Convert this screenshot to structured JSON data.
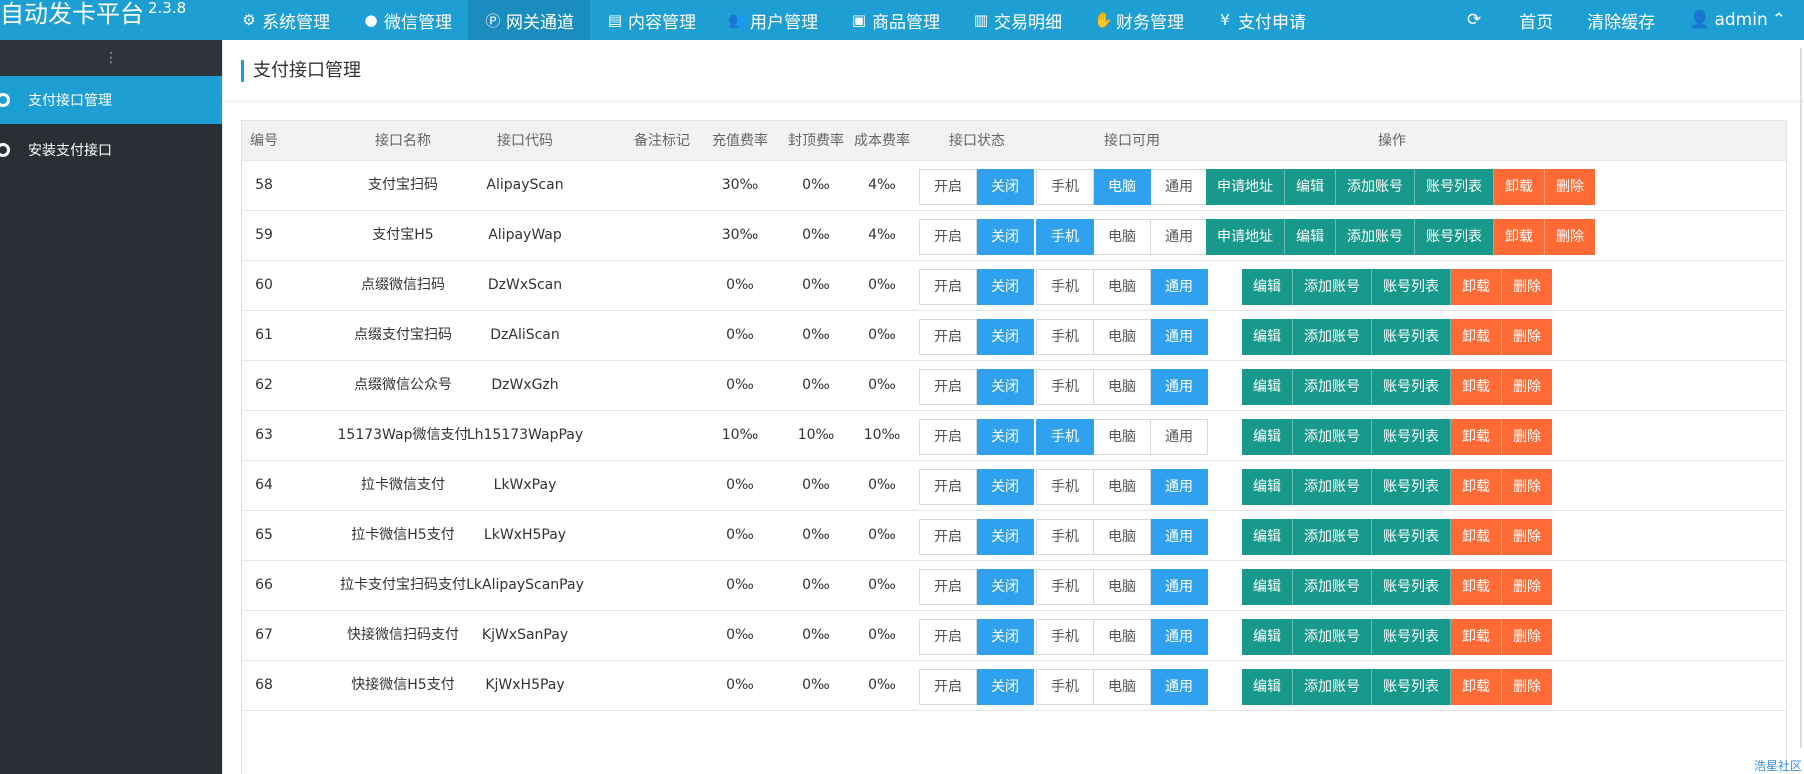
{
  "app": {
    "brand": "自动发卡平台",
    "version": "2.3.8"
  },
  "nav": [
    {
      "icon": "gear-icon",
      "glyph": "⚙",
      "label": "系统管理"
    },
    {
      "icon": "wechat-icon",
      "glyph": "●",
      "label": "微信管理"
    },
    {
      "icon": "gateway-icon",
      "glyph": "Ⓟ",
      "label": "网关通道",
      "active": true
    },
    {
      "icon": "document-icon",
      "glyph": "▤",
      "label": "内容管理"
    },
    {
      "icon": "users-icon",
      "glyph": "👥",
      "label": "用户管理"
    },
    {
      "icon": "bag-icon",
      "glyph": "▣",
      "label": "商品管理"
    },
    {
      "icon": "bar-chart-icon",
      "glyph": "▥",
      "label": "交易明细"
    },
    {
      "icon": "finance-icon",
      "glyph": "✋",
      "label": "财务管理"
    },
    {
      "icon": "yen-icon",
      "glyph": "¥",
      "label": "支付申请"
    }
  ],
  "nav_right": {
    "home": "首页",
    "clear_cache": "清除缓存",
    "user": "admin"
  },
  "sidebar": {
    "items": [
      {
        "label": "支付接口管理",
        "active": true
      },
      {
        "label": "安装支付接口",
        "active": false
      }
    ]
  },
  "page": {
    "title": "支付接口管理"
  },
  "table": {
    "headers": {
      "id": "编号",
      "name": "接口名称",
      "code": "接口代码",
      "note": "备注标记",
      "recharge": "充值费率",
      "cap": "封顶费率",
      "cost": "成本费率",
      "status": "接口状态",
      "avail": "接口可用",
      "ops": "操作"
    },
    "status_labels": [
      "开启",
      "关闭"
    ],
    "avail_labels": [
      "手机",
      "电脑",
      "通用"
    ],
    "op_labels": {
      "apply": "申请地址",
      "edit": "编辑",
      "add": "添加账号",
      "list": "账号列表",
      "uninstall": "卸载",
      "delete": "删除"
    },
    "rows": [
      {
        "id": "58",
        "name": "支付宝扫码",
        "code": "AlipayScan",
        "note": "",
        "recharge": "30‰",
        "cap": "0‰",
        "cost": "4‰",
        "status": 1,
        "avail": 1,
        "apply": true
      },
      {
        "id": "59",
        "name": "支付宝H5",
        "code": "AlipayWap",
        "note": "",
        "recharge": "30‰",
        "cap": "0‰",
        "cost": "4‰",
        "status": 1,
        "avail": 0,
        "apply": true
      },
      {
        "id": "60",
        "name": "点缀微信扫码",
        "code": "DzWxScan",
        "note": "",
        "recharge": "0‰",
        "cap": "0‰",
        "cost": "0‰",
        "status": 1,
        "avail": 2,
        "apply": false
      },
      {
        "id": "61",
        "name": "点缀支付宝扫码",
        "code": "DzAliScan",
        "note": "",
        "recharge": "0‰",
        "cap": "0‰",
        "cost": "0‰",
        "status": 1,
        "avail": 2,
        "apply": false
      },
      {
        "id": "62",
        "name": "点缀微信公众号",
        "code": "DzWxGzh",
        "note": "",
        "recharge": "0‰",
        "cap": "0‰",
        "cost": "0‰",
        "status": 1,
        "avail": 2,
        "apply": false
      },
      {
        "id": "63",
        "name": "15173Wap微信支付",
        "code": "Lh15173WapPay",
        "note": "",
        "recharge": "10‰",
        "cap": "10‰",
        "cost": "10‰",
        "status": 1,
        "avail": 0,
        "apply": false
      },
      {
        "id": "64",
        "name": "拉卡微信支付",
        "code": "LkWxPay",
        "note": "",
        "recharge": "0‰",
        "cap": "0‰",
        "cost": "0‰",
        "status": 1,
        "avail": 2,
        "apply": false
      },
      {
        "id": "65",
        "name": "拉卡微信H5支付",
        "code": "LkWxH5Pay",
        "note": "",
        "recharge": "0‰",
        "cap": "0‰",
        "cost": "0‰",
        "status": 1,
        "avail": 2,
        "apply": false
      },
      {
        "id": "66",
        "name": "拉卡支付宝扫码支付",
        "code": "LkAlipayScanPay",
        "note": "",
        "recharge": "0‰",
        "cap": "0‰",
        "cost": "0‰",
        "status": 1,
        "avail": 2,
        "apply": false
      },
      {
        "id": "67",
        "name": "快接微信扫码支付",
        "code": "KjWxSanPay",
        "note": "",
        "recharge": "0‰",
        "cap": "0‰",
        "cost": "0‰",
        "status": 1,
        "avail": 2,
        "apply": false
      },
      {
        "id": "68",
        "name": "快接微信H5支付",
        "code": "KjWxH5Pay",
        "note": "",
        "recharge": "0‰",
        "cap": "0‰",
        "cost": "0‰",
        "status": 1,
        "avail": 2,
        "apply": false
      }
    ]
  },
  "watermark": "浩星社区"
}
